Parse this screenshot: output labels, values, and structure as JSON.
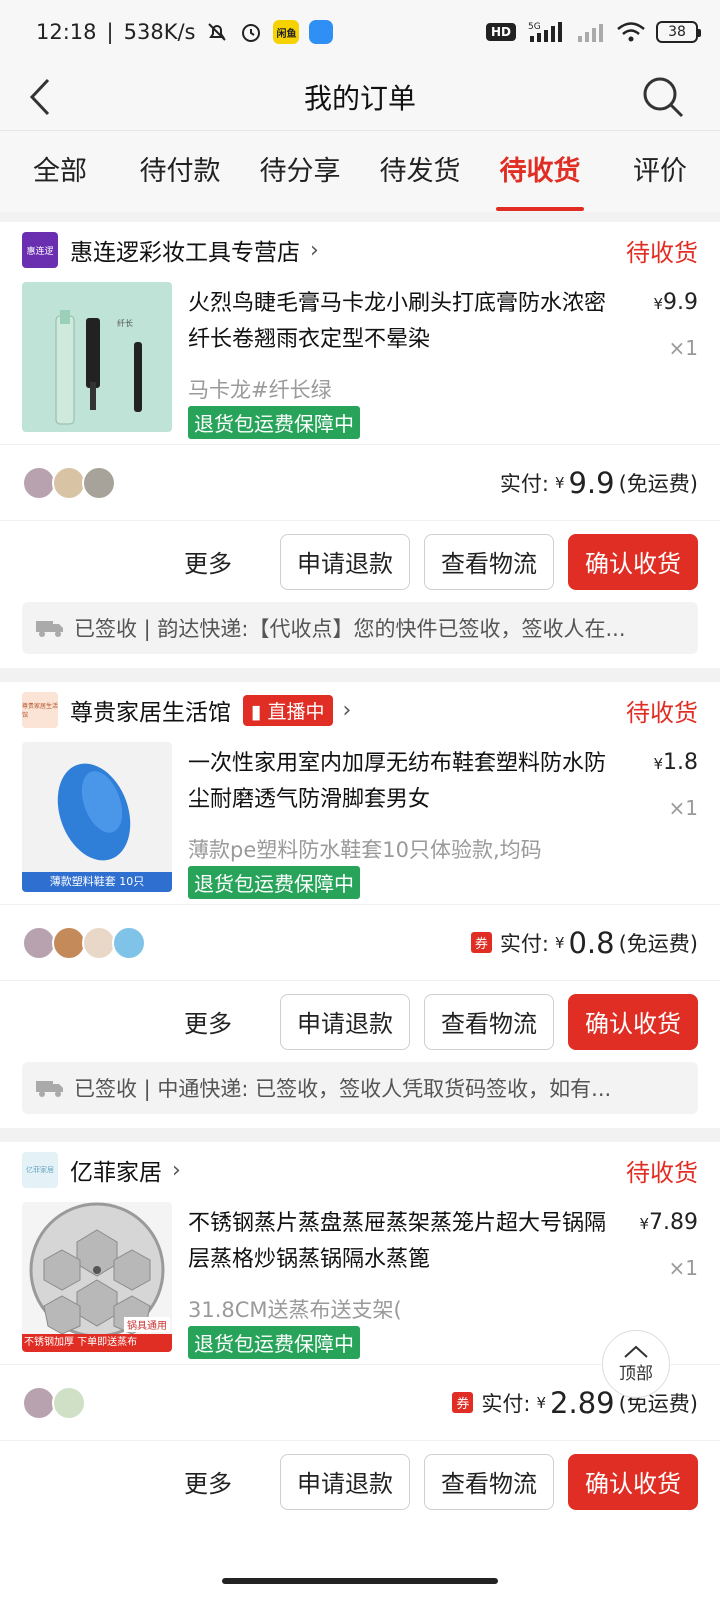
{
  "status_bar": {
    "time": "12:18",
    "speed": "538K/s",
    "network": "5G",
    "battery": "38",
    "hd": "HD",
    "app_label": "闲鱼"
  },
  "header": {
    "title": "我的订单"
  },
  "tabs": [
    "全部",
    "待付款",
    "待分享",
    "待发货",
    "待收货",
    "评价"
  ],
  "active_tab": "待收货",
  "orders": [
    {
      "shop": "惠连逻彩妆工具专营店",
      "shop_logo_text": "惠连逻",
      "status": "待收货",
      "title": "火烈鸟睫毛膏马卡龙小刷头打底膏防水浓密纤长卷翘雨衣定型不晕染",
      "price": "9.9",
      "qty": "×1",
      "spec": "马卡龙#纤长绿",
      "guarantee": "退货包运费保障中",
      "paid_label": "实付:",
      "paid_amount": "9.9",
      "shipping": "(免运费)",
      "logistics": "已签收 | 韵达快递:【代收点】您的快件已签收，签收人在..."
    },
    {
      "shop": "尊贵家居生活馆",
      "shop_logo_text": "尊贵家居生活馆",
      "live_badge": "直播中",
      "status": "待收货",
      "title": "一次性家用室内加厚无纺布鞋套塑料防水防尘耐磨透气防滑脚套男女",
      "price": "1.8",
      "qty": "×1",
      "spec": "薄款pe塑料防水鞋套10只体验款,均码",
      "guarantee": "退货包运费保障中",
      "thumb_caption": "薄款塑料鞋套 10只",
      "coupon": "券",
      "paid_label": "实付:",
      "paid_amount": "0.8",
      "shipping": "(免运费)",
      "logistics": "已签收 | 中通快递: 已签收，签收人凭取货码签收，如有..."
    },
    {
      "shop": "亿菲家居",
      "shop_logo_text": "亿菲家居",
      "status": "待收货",
      "title": "不锈钢蒸片蒸盘蒸屉蒸架蒸笼片超大号锅隔层蒸格炒锅蒸锅隔水蒸篦",
      "price": "7.89",
      "qty": "×1",
      "spec": "31.8CM送蒸布送支架(",
      "guarantee": "退货包运费保障中",
      "thumb_caption": "不锈钢加厚 下单即送蒸布",
      "thumb_badge": "锅具通用",
      "coupon": "券",
      "paid_label": "实付:",
      "paid_amount": "2.89",
      "shipping": "(免运费)"
    }
  ],
  "buttons": {
    "more": "更多",
    "refund": "申请退款",
    "track": "查看物流",
    "confirm": "确认收货"
  },
  "to_top": "顶部",
  "currency": "¥",
  "colors": {
    "accent": "#e02e24",
    "guarantee": "#27a35a"
  }
}
